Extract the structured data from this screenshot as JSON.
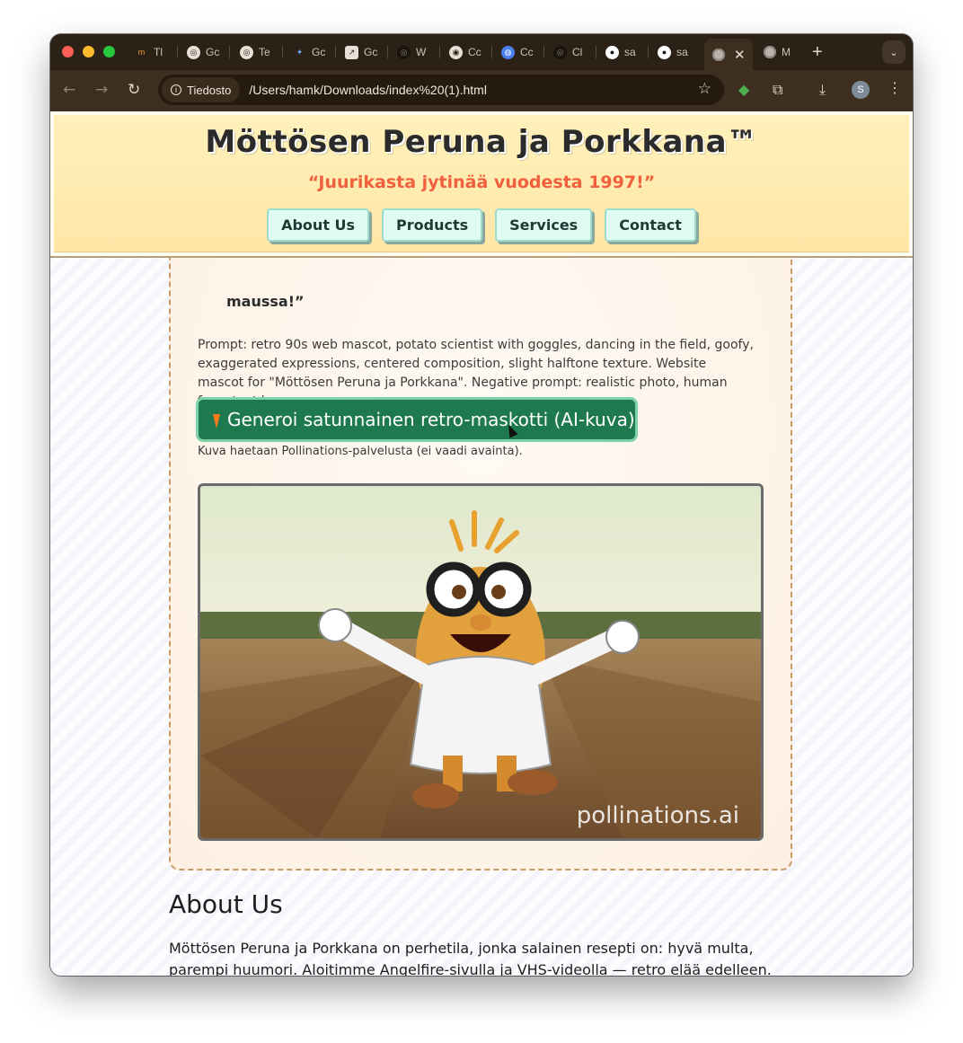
{
  "browser": {
    "tabs": [
      {
        "label": "Tl",
        "icon": "tab-icon-generic"
      },
      {
        "label": "Gc",
        "icon": "tab-icon-openai"
      },
      {
        "label": "Te",
        "icon": "tab-icon-openai"
      },
      {
        "label": "Gc",
        "icon": "tab-icon-gemini"
      },
      {
        "label": "Gc",
        "icon": "tab-icon-generic"
      },
      {
        "label": "W",
        "icon": "tab-icon-generic"
      },
      {
        "label": "Cc",
        "icon": "tab-icon-generic"
      },
      {
        "label": "Cc",
        "icon": "tab-icon-generic"
      },
      {
        "label": "Cl",
        "icon": "tab-icon-generic"
      },
      {
        "label": "sa",
        "icon": "tab-icon-github"
      },
      {
        "label": "sa",
        "icon": "tab-icon-github"
      }
    ],
    "active_tab_close": "✕",
    "last_tab_label": "M",
    "new_tab": "+",
    "security_chip": "Tiedosto",
    "url": "/Users/hamk/Downloads/index%20(1).html",
    "profile_initial": "S"
  },
  "site": {
    "title": "Möttösen Peruna ja Porkkana™",
    "tagline": "“Juurikasta jytinää vuodesta 1997!”",
    "nav": [
      "About Us",
      "Products",
      "Services",
      "Contact"
    ]
  },
  "mascot_section": {
    "quote_tail": "maussa!”",
    "prompt": "Prompt: retro 90s web mascot, potato scientist with goggles, dancing in the field, goofy, exaggerated expressions, centered composition, slight halftone texture. Website mascot for \"Möttösen Peruna ja Porkkana\". Negative prompt: realistic photo, human face, text logo.",
    "button_label": "Generoi satunnainen retro-maskotti (AI-kuva)",
    "note": "Kuva haetaan Pollinations-palvelusta (ei vaadi avainta).",
    "image_watermark": "pollinations.ai"
  },
  "about": {
    "heading": "About Us",
    "text": "Möttösen Peruna ja Porkkana on perhetila, jonka salainen resepti on: hyvä multa, parempi huumori. Aloitimme Angelfire-sivulla ja VHS-videolla — retro elää edelleen."
  }
}
